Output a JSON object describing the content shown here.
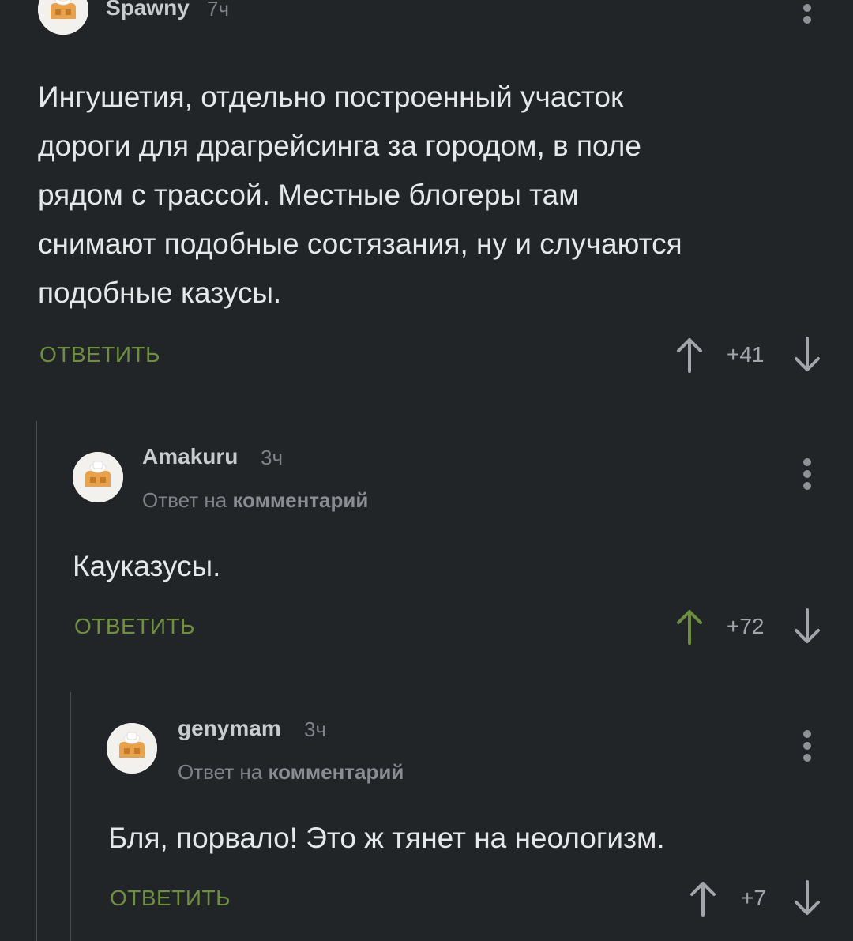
{
  "colors": {
    "background": "#222528",
    "accent_green": "#6f8f3e",
    "thread_line": "#4a4e52"
  },
  "comments": [
    {
      "username": "Spawny",
      "time": "7ч",
      "text_lines": [
        "Ингушетия, отдельно построенный участок",
        "дороги для драгрейсинга за городом, в поле",
        "рядом с трассой. Местные блогеры там",
        "снимают подобные состязания, ну и случаются",
        "подобные казусы."
      ],
      "reply_label": "ОТВЕТИТЬ",
      "rating": "+41",
      "upvoted": false
    },
    {
      "username": "Amakuru",
      "time": "3ч",
      "reply_to_prefix": "Ответ на",
      "reply_to_target": "комментарий",
      "text_lines": [
        "Кауказусы."
      ],
      "reply_label": "ОТВЕТИТЬ",
      "rating": "+72",
      "upvoted": true
    },
    {
      "username": "genymam",
      "time": "3ч",
      "reply_to_prefix": "Ответ на",
      "reply_to_target": "комментарий",
      "text_lines": [
        "Бля, порвало! Это ж тянет на неологизм."
      ],
      "reply_label": "ОТВЕТИТЬ",
      "rating": "+7",
      "upvoted": false
    }
  ],
  "icons": {
    "avatar": "default-pikabu-avatar-icon",
    "menu": "more-vertical-icon",
    "upvote": "arrow-up-icon",
    "downvote": "arrow-down-icon"
  }
}
